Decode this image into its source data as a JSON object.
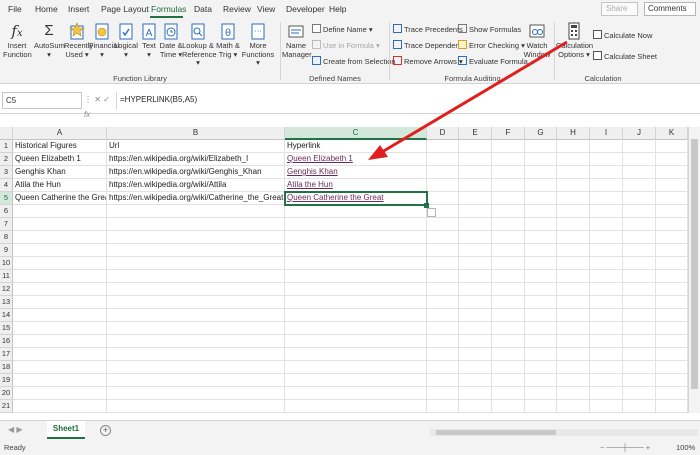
{
  "menu": {
    "tabs": [
      "File",
      "Home",
      "Insert",
      "Page Layout",
      "Formulas",
      "Data",
      "Review",
      "View",
      "Developer",
      "Help"
    ],
    "active": "Formulas",
    "share": "Share",
    "comments": "Comments"
  },
  "ribbon": {
    "insert_function": [
      "Insert",
      "Function"
    ],
    "autosum": "AutoSum",
    "recently_used": [
      "Recently",
      "Used"
    ],
    "financial": "Financial",
    "logical": "Logical",
    "text": "Text",
    "date_time": [
      "Date &",
      "Time"
    ],
    "lookup_reference": [
      "Lookup &",
      "Reference"
    ],
    "math_trig": [
      "Math &",
      "Trig"
    ],
    "more_functions": [
      "More",
      "Functions"
    ],
    "function_library": "Function Library",
    "name_manager": [
      "Name",
      "Manager"
    ],
    "define_name": "Define Name",
    "use_in_formula": "Use in Formula",
    "create_from_selection": "Create from Selection",
    "defined_names": "Defined Names",
    "trace_precedents": "Trace Precedents",
    "trace_dependents": "Trace Dependents",
    "remove_arrows": "Remove Arrows",
    "show_formulas": "Show Formulas",
    "error_checking": "Error Checking",
    "evaluate_formula": "Evaluate Formula",
    "watch_window": [
      "Watch",
      "Window"
    ],
    "formula_auditing": "Formula Auditing",
    "calculation_options": [
      "Calculation",
      "Options"
    ],
    "calculate_now": "Calculate Now",
    "calculate_sheet": "Calculate Sheet",
    "calculation": "Calculation"
  },
  "formula_bar": {
    "name_box": "C5",
    "fx": "fx",
    "formula": "=HYPERLINK(B5,A5)"
  },
  "columns": [
    "A",
    "B",
    "C",
    "D",
    "E",
    "F",
    "G",
    "H",
    "I",
    "J",
    "K"
  ],
  "rows": [
    "1",
    "2",
    "3",
    "4",
    "5",
    "6",
    "7",
    "8",
    "9",
    "10",
    "11",
    "12",
    "13",
    "14",
    "15",
    "16",
    "17",
    "18",
    "19",
    "20",
    "21"
  ],
  "cells": {
    "A1": "Historical Figures",
    "B1": "Url",
    "C1": "Hyperlink",
    "A2": "Queen Elizabeth 1",
    "B2": "https://en.wikipedia.org/wiki/Elizabeth_I",
    "C2": "Queen Elizabeth 1",
    "A3": "Genghis Khan",
    "B3": "https://en.wikipedia.org/wiki/Genghis_Khan",
    "C3": "Genghis Khan",
    "A4": "Atila the Hun",
    "B4": "https://en.wikipedia.org/wiki/Attila",
    "C4": "Atila the Hun",
    "A5": "Queen Catherine the Great",
    "B5": "https://en.wikipedia.org/wiki/Catherine_the_Great",
    "C5": "Queen Catherine the Great"
  },
  "sheet": {
    "tab": "Sheet1"
  },
  "status": {
    "ready": "Ready",
    "zoom": "100%"
  },
  "colors": {
    "accent": "#217346",
    "link": "#6b2b5b",
    "arrow": "#e02020"
  }
}
